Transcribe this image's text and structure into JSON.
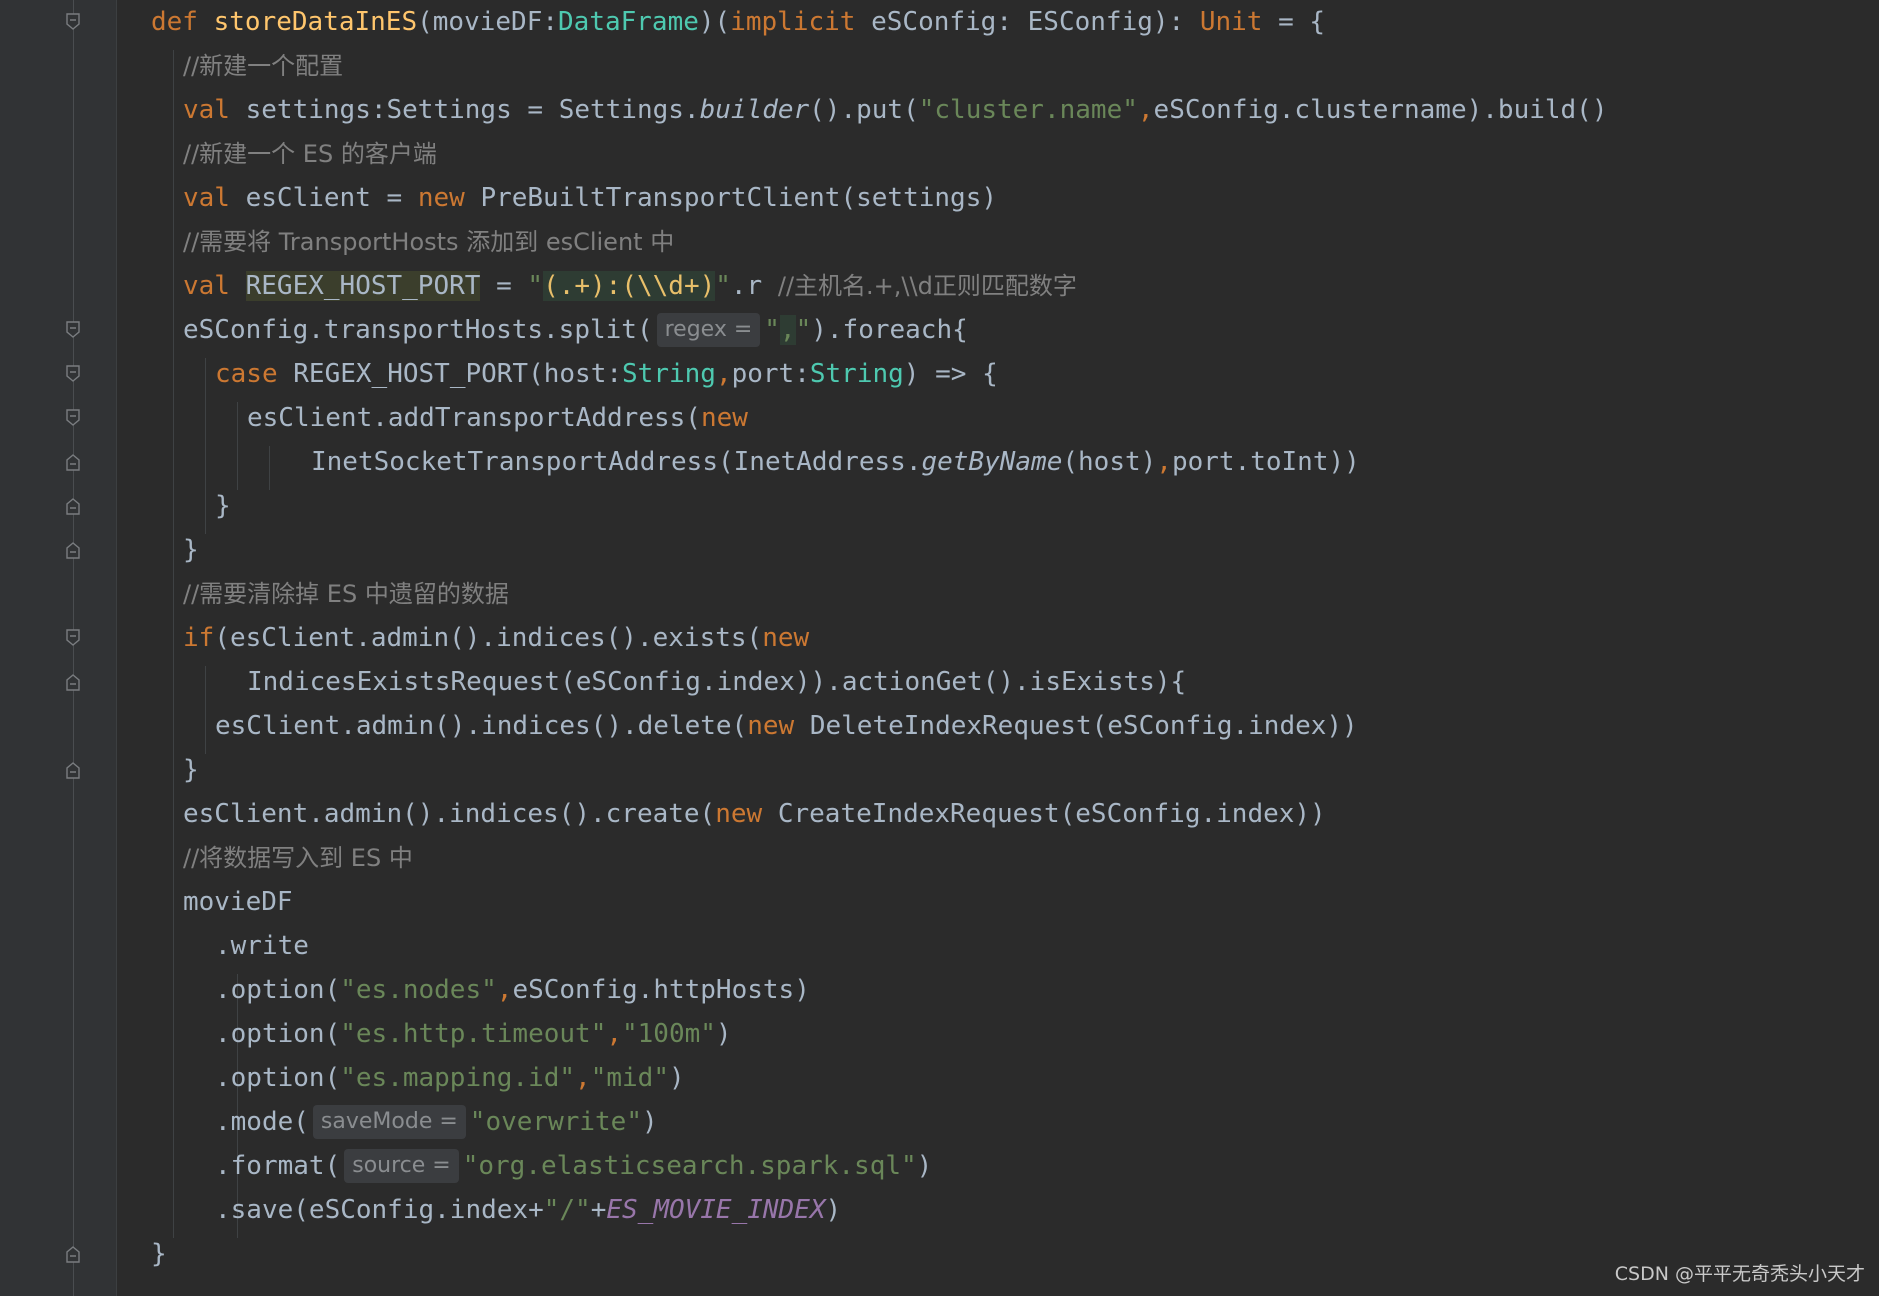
{
  "lines": [
    {
      "indent": 0,
      "tokens": [
        {
          "t": "def ",
          "c": "kw"
        },
        {
          "t": "storeDataInES",
          "c": "fn"
        },
        {
          "t": "(movieDF:",
          "c": "plain"
        },
        {
          "t": "DataFrame",
          "c": "type"
        },
        {
          "t": ")(",
          "c": "plain"
        },
        {
          "t": "implicit ",
          "c": "kw"
        },
        {
          "t": "eSConfig: ESConfig): ",
          "c": "plain"
        },
        {
          "t": "Unit",
          "c": "kw"
        },
        {
          "t": " = {",
          "c": "plain"
        }
      ]
    },
    {
      "indent": 1,
      "tokens": [
        {
          "t": "//新建一个配置",
          "c": "cm"
        }
      ]
    },
    {
      "indent": 1,
      "tokens": [
        {
          "t": "val ",
          "c": "kw"
        },
        {
          "t": "settings:Settings = Settings.",
          "c": "plain"
        },
        {
          "t": "builder",
          "c": "it"
        },
        {
          "t": "().put(",
          "c": "plain"
        },
        {
          "t": "\"cluster.name\"",
          "c": "str"
        },
        {
          "t": ",",
          "c": "kw"
        },
        {
          "t": "eSConfig.clustername).build()",
          "c": "plain"
        }
      ]
    },
    {
      "indent": 1,
      "tokens": [
        {
          "t": "//新建一个 ES 的客户端",
          "c": "cm"
        }
      ]
    },
    {
      "indent": 1,
      "tokens": [
        {
          "t": "val ",
          "c": "kw"
        },
        {
          "t": "esClient = ",
          "c": "plain"
        },
        {
          "t": "new ",
          "c": "kw"
        },
        {
          "t": "PreBuiltTransportClient(settings)",
          "c": "plain"
        }
      ]
    },
    {
      "indent": 1,
      "tokens": [
        {
          "t": "//需要将 TransportHosts 添加到 esClient 中",
          "c": "cm"
        }
      ]
    },
    {
      "indent": 1,
      "tokens": [
        {
          "t": "val ",
          "c": "kw"
        },
        {
          "t": "REGEX_HOST_PORT",
          "c": "hl"
        },
        {
          "t": " = ",
          "c": "plain"
        },
        {
          "t": "\"",
          "c": "str"
        },
        {
          "t": "(.+):(\\\\d+)",
          "c": "hlstr"
        },
        {
          "t": "\"",
          "c": "str"
        },
        {
          "t": ".r ",
          "c": "plain"
        },
        {
          "t": "//主机名.+,\\\\d正则匹配数字",
          "c": "cm"
        }
      ]
    },
    {
      "indent": 1,
      "tokens": [
        {
          "t": "eSConfig.transportHosts.split(",
          "c": "plain"
        },
        {
          "t": "regex =",
          "c": "hint"
        },
        {
          "t": "\"",
          "c": "str"
        },
        {
          "t": ",",
          "c": "hlstr2"
        },
        {
          "t": "\"",
          "c": "str"
        },
        {
          "t": ").foreach{",
          "c": "plain"
        }
      ]
    },
    {
      "indent": 2,
      "tokens": [
        {
          "t": "case ",
          "c": "kw"
        },
        {
          "t": "REGEX_HOST_PORT(host:",
          "c": "plain"
        },
        {
          "t": "String",
          "c": "type"
        },
        {
          "t": ",",
          "c": "kw"
        },
        {
          "t": "port:",
          "c": "plain"
        },
        {
          "t": "String",
          "c": "type"
        },
        {
          "t": ") => {",
          "c": "plain"
        }
      ]
    },
    {
      "indent": 3,
      "tokens": [
        {
          "t": "esClient.addTransportAddress(",
          "c": "plain"
        },
        {
          "t": "new",
          "c": "kw"
        }
      ]
    },
    {
      "indent": 5,
      "tokens": [
        {
          "t": "InetSocketTransportAddress(InetAddress.",
          "c": "plain"
        },
        {
          "t": "getByName",
          "c": "it"
        },
        {
          "t": "(host)",
          "c": "plain"
        },
        {
          "t": ",",
          "c": "kw"
        },
        {
          "t": "port.toInt))",
          "c": "plain"
        }
      ]
    },
    {
      "indent": 2,
      "tokens": [
        {
          "t": "}",
          "c": "plain"
        }
      ]
    },
    {
      "indent": 1,
      "tokens": [
        {
          "t": "}",
          "c": "plain"
        }
      ]
    },
    {
      "indent": 1,
      "tokens": [
        {
          "t": "//需要清除掉 ES 中遗留的数据",
          "c": "cm"
        }
      ]
    },
    {
      "indent": 1,
      "tokens": [
        {
          "t": "if",
          "c": "kw"
        },
        {
          "t": "(esClient.admin().indices().exists(",
          "c": "plain"
        },
        {
          "t": "new",
          "c": "kw"
        }
      ]
    },
    {
      "indent": 3,
      "tokens": [
        {
          "t": "IndicesExistsRequest(eSConfig.index)).actionGet().isExists){",
          "c": "plain"
        }
      ]
    },
    {
      "indent": 2,
      "tokens": [
        {
          "t": "esClient.admin().indices().delete(",
          "c": "plain"
        },
        {
          "t": "new ",
          "c": "kw"
        },
        {
          "t": "DeleteIndexRequest(eSConfig.index))",
          "c": "plain"
        }
      ]
    },
    {
      "indent": 1,
      "tokens": [
        {
          "t": "}",
          "c": "plain"
        }
      ]
    },
    {
      "indent": 1,
      "tokens": [
        {
          "t": "esClient.admin().indices().create(",
          "c": "plain"
        },
        {
          "t": "new ",
          "c": "kw"
        },
        {
          "t": "CreateIndexRequest(eSConfig.index))",
          "c": "plain"
        }
      ]
    },
    {
      "indent": 1,
      "tokens": [
        {
          "t": "//将数据写入到 ES 中",
          "c": "cm"
        }
      ]
    },
    {
      "indent": 1,
      "tokens": [
        {
          "t": "movieDF",
          "c": "plain"
        }
      ]
    },
    {
      "indent": 2,
      "tokens": [
        {
          "t": ".write",
          "c": "plain"
        }
      ]
    },
    {
      "indent": 2,
      "tokens": [
        {
          "t": ".option(",
          "c": "plain"
        },
        {
          "t": "\"es.nodes\"",
          "c": "str"
        },
        {
          "t": ",",
          "c": "kw"
        },
        {
          "t": "eSConfig.httpHosts)",
          "c": "plain"
        }
      ]
    },
    {
      "indent": 2,
      "tokens": [
        {
          "t": ".option(",
          "c": "plain"
        },
        {
          "t": "\"es.http.timeout\"",
          "c": "str"
        },
        {
          "t": ",",
          "c": "kw"
        },
        {
          "t": "\"100m\"",
          "c": "str"
        },
        {
          "t": ")",
          "c": "plain"
        }
      ]
    },
    {
      "indent": 2,
      "tokens": [
        {
          "t": ".option(",
          "c": "plain"
        },
        {
          "t": "\"es.mapping.id\"",
          "c": "str"
        },
        {
          "t": ",",
          "c": "kw"
        },
        {
          "t": "\"mid\"",
          "c": "str"
        },
        {
          "t": ")",
          "c": "plain"
        }
      ]
    },
    {
      "indent": 2,
      "tokens": [
        {
          "t": ".mode(",
          "c": "plain"
        },
        {
          "t": "saveMode =",
          "c": "hint"
        },
        {
          "t": "\"overwrite\"",
          "c": "str"
        },
        {
          "t": ")",
          "c": "plain"
        }
      ]
    },
    {
      "indent": 2,
      "tokens": [
        {
          "t": ".format(",
          "c": "plain"
        },
        {
          "t": "source =",
          "c": "hint"
        },
        {
          "t": "\"org.elasticsearch.spark.sql\"",
          "c": "str"
        },
        {
          "t": ")",
          "c": "plain"
        }
      ]
    },
    {
      "indent": 2,
      "tokens": [
        {
          "t": ".save(eSConfig.index+",
          "c": "plain"
        },
        {
          "t": "\"/\"",
          "c": "str"
        },
        {
          "t": "+",
          "c": "plain"
        },
        {
          "t": "ES_MOVIE_INDEX",
          "c": "const"
        },
        {
          "t": ")",
          "c": "plain"
        }
      ]
    },
    {
      "indent": 0,
      "tokens": [
        {
          "t": "}",
          "c": "plain"
        }
      ]
    }
  ],
  "fold_markers": [
    {
      "line": 0,
      "kind": "open"
    },
    {
      "line": 7,
      "kind": "open"
    },
    {
      "line": 8,
      "kind": "open"
    },
    {
      "line": 9,
      "kind": "open"
    },
    {
      "line": 10,
      "kind": "close"
    },
    {
      "line": 11,
      "kind": "close"
    },
    {
      "line": 12,
      "kind": "close"
    },
    {
      "line": 14,
      "kind": "open"
    },
    {
      "line": 15,
      "kind": "close"
    },
    {
      "line": 17,
      "kind": "close"
    },
    {
      "line": 28,
      "kind": "close"
    }
  ],
  "watermark": "CSDN @平平无奇秃头小天才"
}
